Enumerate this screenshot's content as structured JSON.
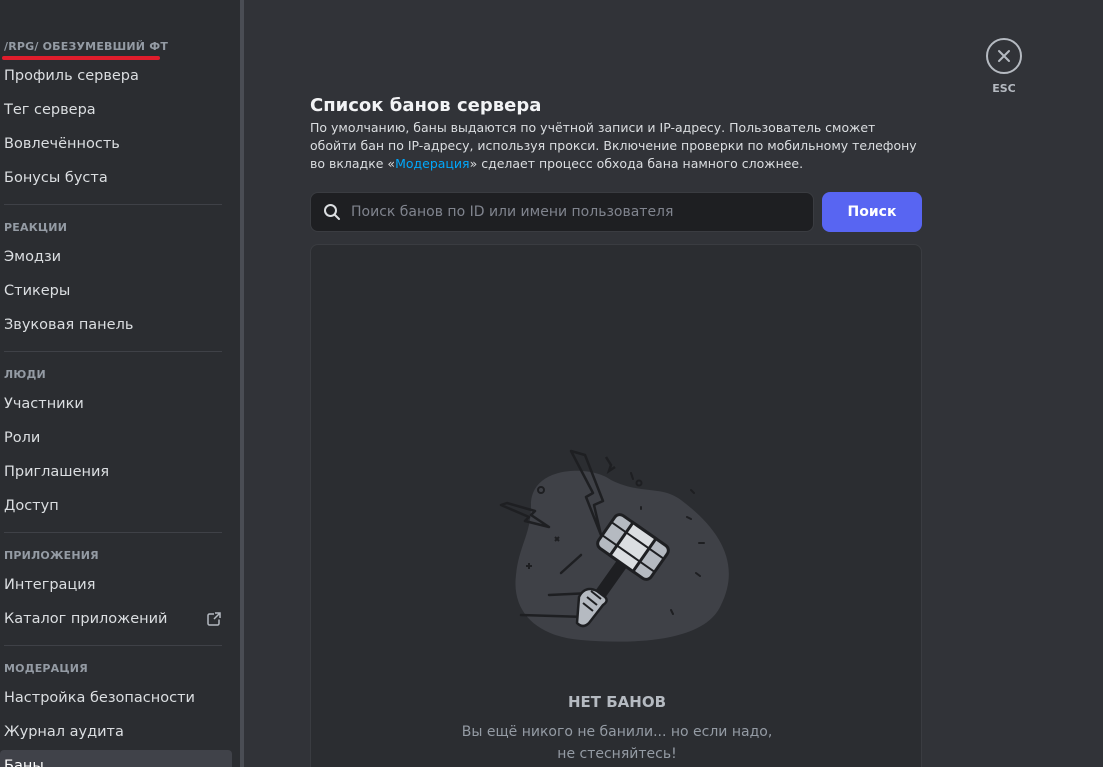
{
  "sidebar": {
    "server_name": "/RPG/ ОБЕЗУМЕВШИЙ ФТ",
    "server_items": [
      "Профиль сервера",
      "Тег сервера",
      "Вовлечённость",
      "Бонусы буста"
    ],
    "reactions_header": "РЕАКЦИИ",
    "reactions_items": [
      "Эмодзи",
      "Стикеры",
      "Звуковая панель"
    ],
    "people_header": "ЛЮДИ",
    "people_items": [
      "Участники",
      "Роли",
      "Приглашения",
      "Доступ"
    ],
    "apps_header": "ПРИЛОЖЕНИЯ",
    "apps_items": [
      "Интеграция",
      "Каталог приложений"
    ],
    "moderation_header": "МОДЕРАЦИЯ",
    "moderation_items": [
      "Настройка безопасности",
      "Журнал аудита",
      "Баны"
    ]
  },
  "close": {
    "label": "ESC"
  },
  "main": {
    "title": "Список банов сервера",
    "description_1": "По умолчанию, баны выдаются по учётной записи и IP-адресу. Пользователь сможет обойти бан по IP-адресу, используя прокси. Включение проверки по мобильному телефону во вкладке «",
    "description_link": "Модерация",
    "description_2": "» сделает процесс обхода бана намного сложнее.",
    "search_placeholder": "Поиск банов по ID или имени пользователя",
    "search_button": "Поиск",
    "empty_title": "НЕТ БАНОВ",
    "empty_text_1": "Вы ещё никого не банили... но если надо,",
    "empty_text_2": "не стесняйтесь!"
  },
  "colors": {
    "accent": "#5865f2",
    "link": "#00a8fc",
    "underline": "#e01d2c"
  }
}
